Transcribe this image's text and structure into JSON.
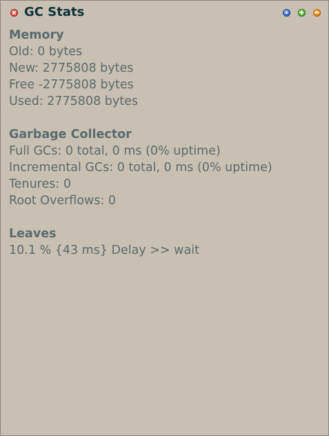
{
  "window": {
    "title": "GC Stats",
    "close_icon": "close-icon",
    "collapse_icon": "chevron-down-icon",
    "expand_icon": "plus-icon",
    "minimize_icon": "minus-icon"
  },
  "sections": [
    {
      "heading": "Memory",
      "lines": [
        "Old: 0 bytes",
        "New: 2775808 bytes",
        "Free -2775808 bytes",
        "Used: 2775808 bytes"
      ]
    },
    {
      "heading": "Garbage Collector",
      "lines": [
        "Full GCs: 0 total, 0 ms (0% uptime)",
        "Incremental GCs: 0 total, 0 ms (0% uptime)",
        "Tenures: 0",
        "Root Overflows: 0"
      ]
    },
    {
      "heading": "Leaves",
      "lines": [
        "10.1 % {43 ms} Delay >> wait"
      ]
    }
  ],
  "colors": {
    "background": "#c8c1b3",
    "title_text": "#0f2f3a",
    "body_text": "#5c6a6e",
    "close": "#d8322c",
    "collapse": "#2e63c9",
    "expand": "#3f9b25",
    "minimize": "#e67d10"
  }
}
